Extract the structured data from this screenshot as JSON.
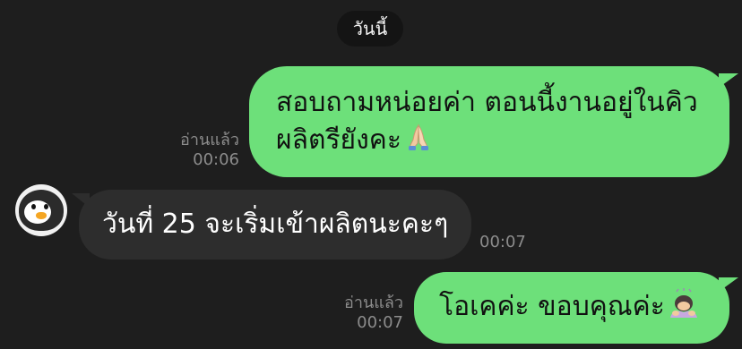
{
  "date_separator": "วันนี้",
  "messages": [
    {
      "direction": "outgoing",
      "lines": [
        "สอบถามหน่อยค่า ตอนนี้งานอยู่ในคิว",
        "ผลิตรียังคะ"
      ],
      "emoji_icon": "folded-hands-icon",
      "read_label": "อ่านแล้ว",
      "time": "00:06"
    },
    {
      "direction": "incoming",
      "sender_avatar": "penguin-icon",
      "text": "วันที่ 25 จะเริ่มเข้าผลิตนะคะๆ",
      "time": "00:07"
    },
    {
      "direction": "outgoing",
      "text": "โอเคค่ะ ขอบคุณค่ะ",
      "emoji_icon": "person-bowing-icon",
      "read_label": "อ่านแล้ว",
      "time": "00:07"
    }
  ],
  "colors": {
    "background": "#1e1e1e",
    "outgoing_bubble": "#6de07a",
    "incoming_bubble": "#2d2d2d",
    "meta_text": "#8c8c8c"
  }
}
